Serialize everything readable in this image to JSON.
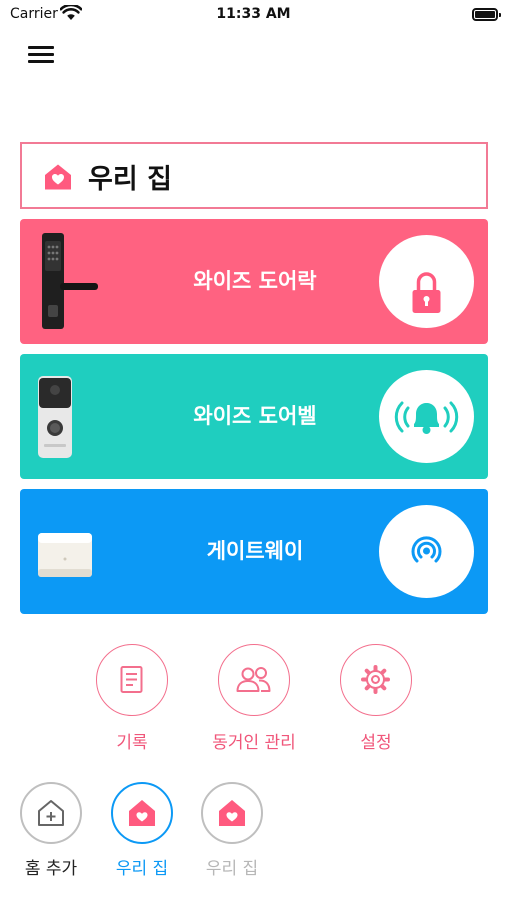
{
  "status_bar": {
    "carrier": "Carrier",
    "time": "11:33 AM"
  },
  "header": {
    "home_title": "우리 집"
  },
  "devices": [
    {
      "label": "와이즈 도어락",
      "color": "#ff6281",
      "icon": "padlock-icon"
    },
    {
      "label": "와이즈 도어벨",
      "color": "#1fcebf",
      "icon": "ringing-bell-icon"
    },
    {
      "label": "게이트웨이",
      "color": "#0c99f5",
      "icon": "signal-broadcast-icon"
    }
  ],
  "actions": [
    {
      "label": "기록",
      "icon": "document-icon"
    },
    {
      "label": "동거인 관리",
      "icon": "people-icon"
    },
    {
      "label": "설정",
      "icon": "gear-icon"
    }
  ],
  "homes": [
    {
      "label": "홈 추가",
      "icon": "add-home-icon",
      "state": "normal"
    },
    {
      "label": "우리 집",
      "icon": "home-heart-icon",
      "state": "selected"
    },
    {
      "label": "우리 집",
      "icon": "home-heart-icon",
      "state": "unselected"
    }
  ],
  "colors": {
    "accent_pink": "#ff6281",
    "accent_teal": "#1fcebf",
    "accent_blue": "#0c99f5"
  }
}
